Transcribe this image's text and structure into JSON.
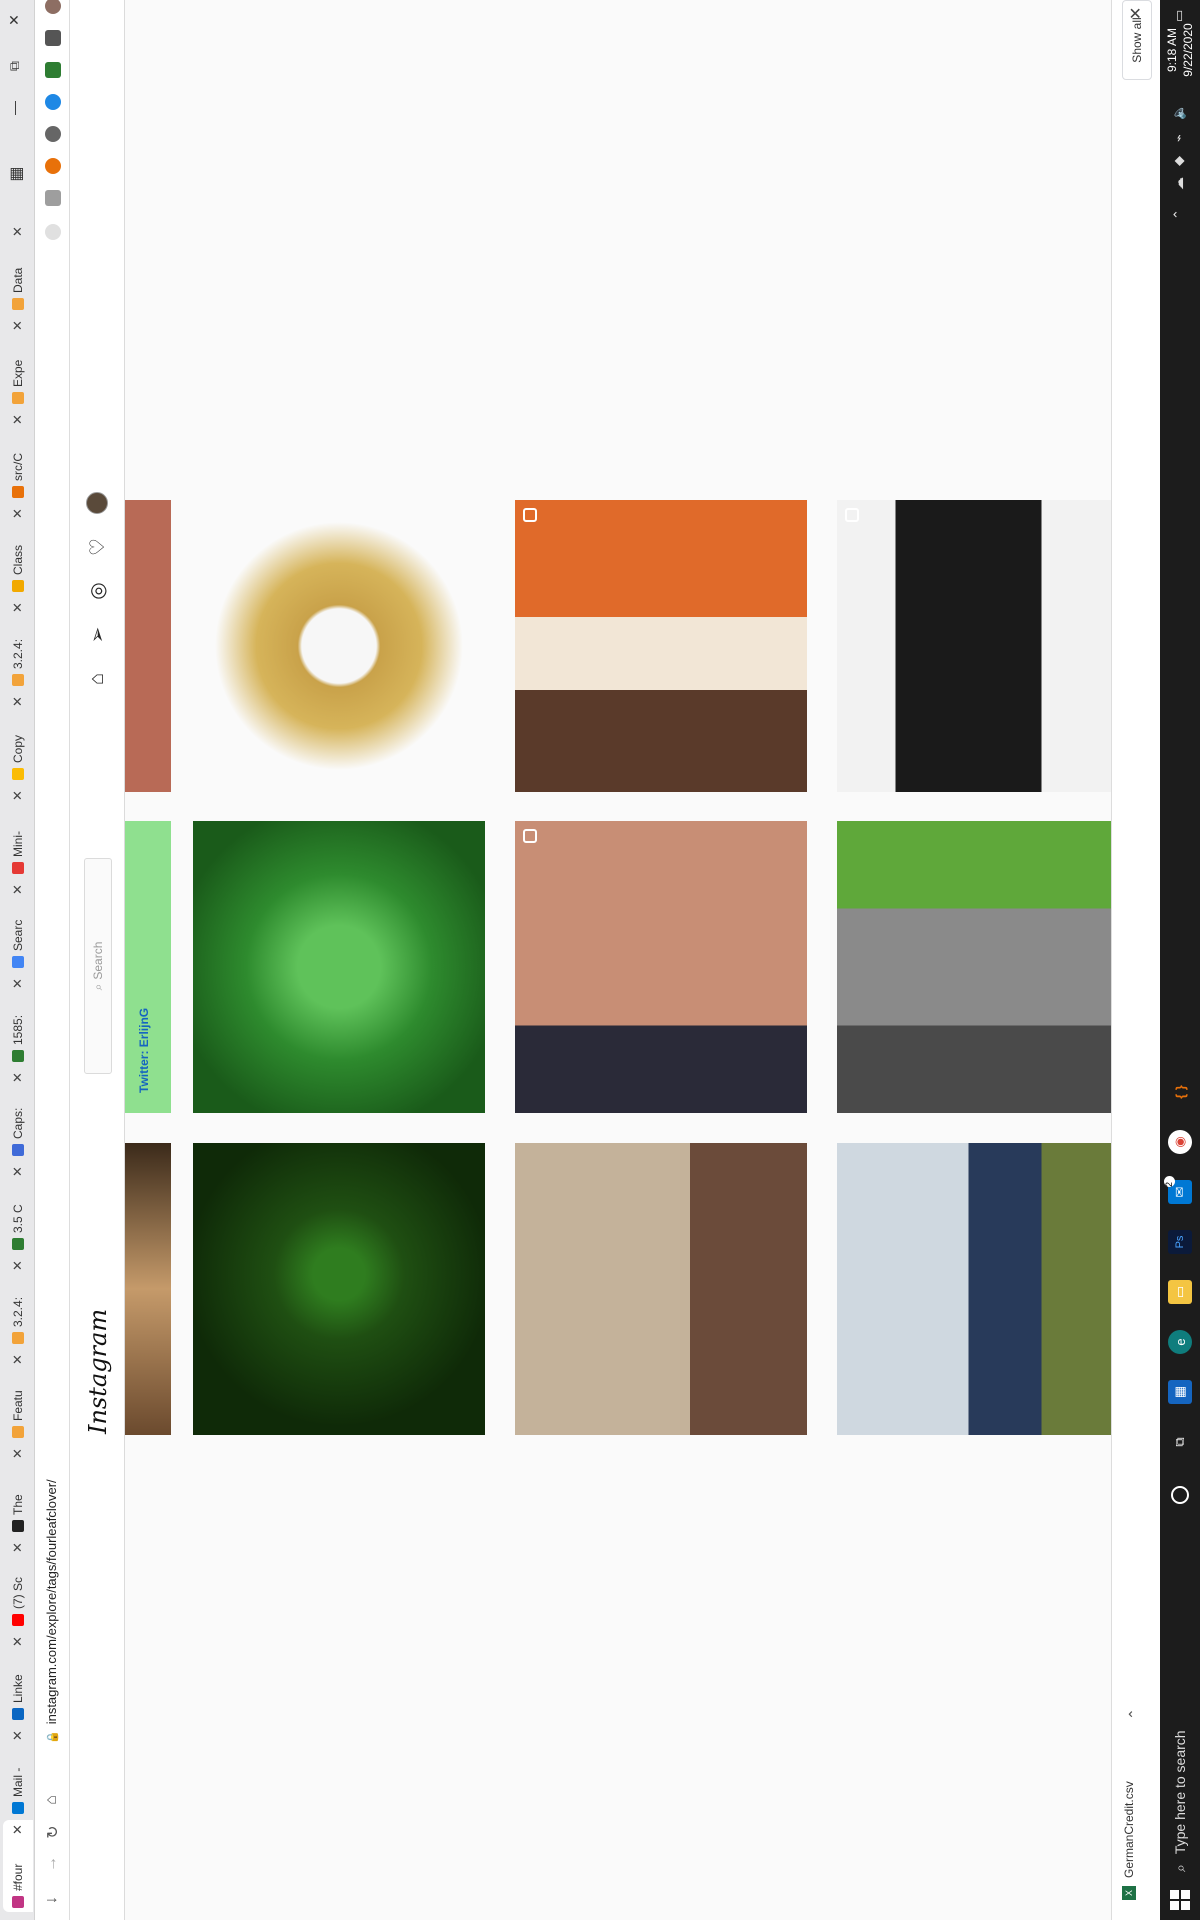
{
  "browser": {
    "tabs": [
      {
        "label": "#four",
        "color": "#c13584",
        "active": true
      },
      {
        "label": "Mail -",
        "color": "#0078d4"
      },
      {
        "label": "Linke",
        "color": "#0a66c2"
      },
      {
        "label": "(7) Sc",
        "color": "#ff0000"
      },
      {
        "label": "The",
        "color": "#222222"
      },
      {
        "label": "Featu",
        "color": "#f2a33a"
      },
      {
        "label": "3.2.4:",
        "color": "#f2a33a"
      },
      {
        "label": "3.5 C",
        "color": "#2e7d32"
      },
      {
        "label": "Caps:",
        "color": "#3f6ad8"
      },
      {
        "label": "1585:",
        "color": "#2e7d32"
      },
      {
        "label": "Searc",
        "color": "#4285f4"
      },
      {
        "label": "Mini-",
        "color": "#e53935"
      },
      {
        "label": "Copy",
        "color": "#fbbc04"
      },
      {
        "label": "3.2.4:",
        "color": "#f2a33a"
      },
      {
        "label": "Class",
        "color": "#f2a900"
      },
      {
        "label": "src/C",
        "color": "#e8710a"
      },
      {
        "label": "Expe",
        "color": "#f2a33a"
      },
      {
        "label": "Data",
        "color": "#f2a33a"
      }
    ],
    "url": "instagram.com/explore/tags/fourleafclover/"
  },
  "instagram": {
    "logo": "Instagram",
    "search_placeholder": "Search",
    "nav": [
      "home-icon",
      "direct-icon",
      "explore-icon",
      "heart-icon",
      "avatar"
    ]
  },
  "downloads": {
    "file": "GermanCredit.csv",
    "show_all": "Show all"
  },
  "taskbar": {
    "search_placeholder": "Type here to search",
    "time": "9:18 AM",
    "date": "9/22/2020",
    "mail_badge": "2"
  }
}
